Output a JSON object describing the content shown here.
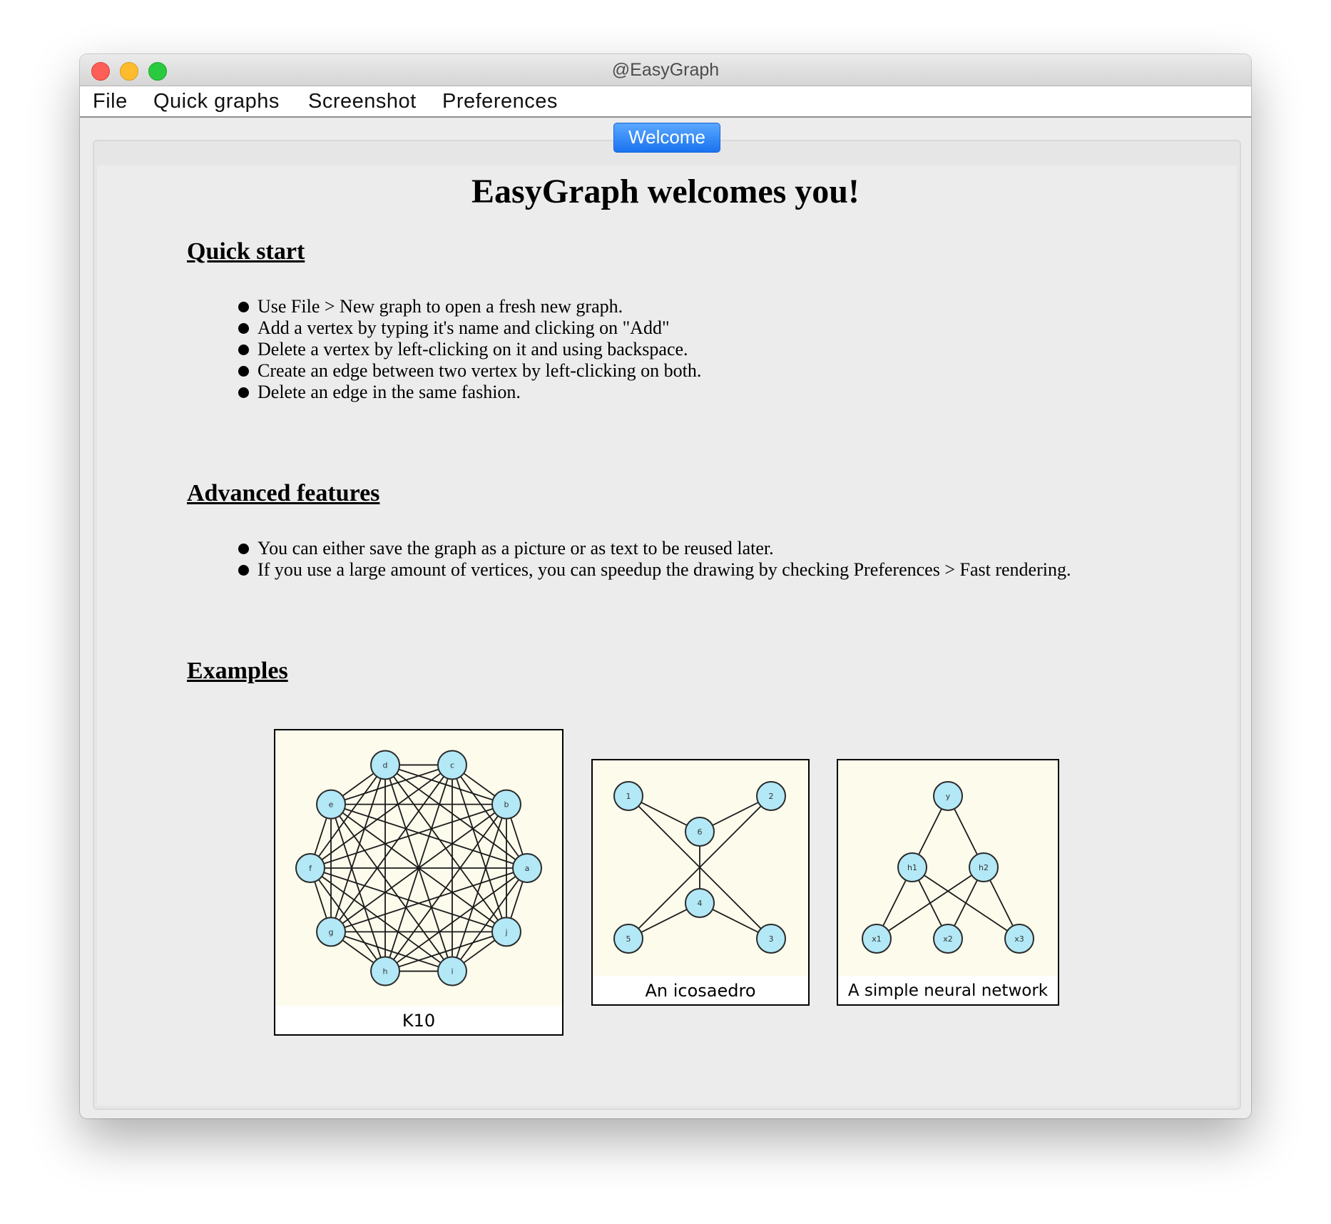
{
  "window": {
    "title": "@EasyGraph"
  },
  "menu": {
    "items": [
      {
        "label": "File"
      },
      {
        "label": "Quick graphs"
      },
      {
        "label": "Screenshot"
      },
      {
        "label": "Preferences"
      }
    ]
  },
  "tab": {
    "label": "Welcome"
  },
  "welcome": {
    "heading": "EasyGraph welcomes you!",
    "quick_start": {
      "title": "Quick start",
      "items": [
        "Use File > New graph to open a fresh new graph.",
        "Add a vertex by typing it's name and clicking on \"Add\"",
        "Delete a vertex by left-clicking on it and using backspace.",
        "Create an edge between two vertex by left-clicking on both.",
        "Delete an edge in the same fashion."
      ]
    },
    "advanced": {
      "title": "Advanced features",
      "items": [
        "You can either save the graph as a picture or as text to be reused later.",
        "If you use a large amount of vertices, you can speedup the drawing by checking Preferences > Fast rendering."
      ]
    },
    "examples": {
      "title": "Examples",
      "items": [
        {
          "caption": "K10",
          "nodes": [
            "a",
            "b",
            "c",
            "d",
            "e",
            "f",
            "g",
            "h",
            "i",
            "j"
          ],
          "edges": "complete"
        },
        {
          "caption": "An icosaedro",
          "nodes": [
            "1",
            "2",
            "6",
            "4",
            "5",
            "3"
          ],
          "edges": [
            [
              "1",
              "6"
            ],
            [
              "1",
              "3"
            ],
            [
              "2",
              "6"
            ],
            [
              "2",
              "5"
            ],
            [
              "6",
              "4"
            ],
            [
              "4",
              "5"
            ],
            [
              "4",
              "3"
            ]
          ]
        },
        {
          "caption": "A simple neural network",
          "nodes": [
            "y",
            "h1",
            "h2",
            "x1",
            "x2",
            "x3"
          ],
          "edges": [
            [
              "y",
              "h1"
            ],
            [
              "y",
              "h2"
            ],
            [
              "h1",
              "x1"
            ],
            [
              "h1",
              "x2"
            ],
            [
              "h1",
              "x3"
            ],
            [
              "h2",
              "x1"
            ],
            [
              "h2",
              "x2"
            ],
            [
              "h2",
              "x3"
            ]
          ]
        }
      ]
    }
  },
  "colors": {
    "canvas_bg": "#fdfbec",
    "node_fill": "#b3e8f6",
    "node_stroke": "#2a2a2a",
    "accent_tab": "#1a73f0"
  }
}
